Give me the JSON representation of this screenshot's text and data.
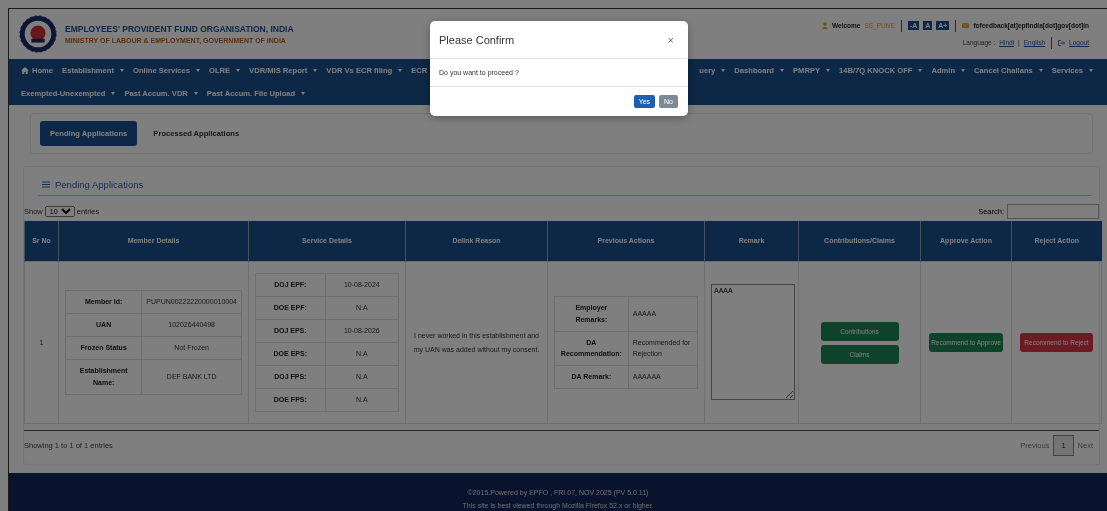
{
  "header": {
    "org_name": "EMPLOYEES' PROVIDENT FUND ORGANISATION, INDIA",
    "ministry": "MINISTRY OF LABOUR & EMPLOYMENT, GOVERNMENT OF INDIA",
    "welcome_label": "Welcome",
    "user": "SS_PUNE",
    "font_buttons": [
      "-A",
      "A",
      "A+"
    ],
    "email": "fofeedback[at]epfindia[dot]gov[dot]in",
    "language_label": "Language :",
    "languages": [
      "Hindi",
      "English"
    ],
    "language_separator": "|",
    "logout": "Logout"
  },
  "nav": {
    "rows": [
      {
        "left": [
          {
            "label": "Home",
            "kind": "home"
          },
          {
            "label": "Establishment",
            "kind": "dropdown"
          },
          {
            "label": "Online Services",
            "kind": "dropdown"
          },
          {
            "label": "OLRE",
            "kind": "dropdown"
          },
          {
            "label": "VDR/MIS Report",
            "kind": "dropdown"
          },
          {
            "label": "VDR Vs ECR filing",
            "kind": "dropdown"
          },
          {
            "label": "ECR",
            "kind": "plain"
          }
        ],
        "right": [
          {
            "label": "uery",
            "kind": "dropdown"
          },
          {
            "label": "Dashboard",
            "kind": "dropdown"
          },
          {
            "label": "PMRPY",
            "kind": "dropdown"
          },
          {
            "label": "14B/7Q KNOCK OFF",
            "kind": "dropdown"
          },
          {
            "label": "Admin",
            "kind": "dropdown"
          },
          {
            "label": "Cancel Challans",
            "kind": "dropdown"
          },
          {
            "label": "Services",
            "kind": "dropdown"
          }
        ]
      },
      {
        "left": [
          {
            "label": "Exempted-Unexempted",
            "kind": "dropdown"
          },
          {
            "label": "Past Accum. VDR",
            "kind": "dropdown"
          },
          {
            "label": "Past Accum. File Upload",
            "kind": "dropdown"
          }
        ],
        "right": []
      }
    ]
  },
  "tabs": [
    {
      "label": "Pending Applications",
      "selected": true
    },
    {
      "label": "Processed Applications",
      "selected": false
    }
  ],
  "panel": {
    "title": "Pending Applications",
    "show_label": "Show",
    "page_size": "10",
    "entries_label": "entries",
    "search_label": "Search:",
    "columns": [
      "Sr No",
      "Member Details",
      "Service Details",
      "Delink Reason",
      "Previous Actions",
      "Remark",
      "Contributions/Claims",
      "Approve Action",
      "Reject Action"
    ],
    "rows": [
      {
        "sr": "1",
        "member_details": [
          {
            "label": "Member Id:",
            "value": "PUPUN00222220000010004"
          },
          {
            "label": "UAN",
            "value": "102026440498"
          },
          {
            "label": "Frozen Status",
            "value": "Not Frozen"
          },
          {
            "label": "Establishment Name:",
            "value": "DEF BANK LTD"
          }
        ],
        "service_details": [
          {
            "label": "DOJ EPF:",
            "value": "10-08-2024"
          },
          {
            "label": "DOE EPF:",
            "value": "N.A"
          },
          {
            "label": "DOJ EPS:",
            "value": "10-08-2026"
          },
          {
            "label": "DOE EPS:",
            "value": "N.A"
          },
          {
            "label": "DOJ FPS:",
            "value": "N.A"
          },
          {
            "label": "DOE FPS:",
            "value": "N.A"
          }
        ],
        "delink_reason": "I never worked in this establishment and my UAN was added without my consent.",
        "previous_actions": [
          {
            "label": "Employer Remarks:",
            "value": "AAAAA"
          },
          {
            "label": "DA Recommendation:",
            "value": "Recommended for Rejection"
          },
          {
            "label": "DA Remark:",
            "value": "AAAAAA"
          }
        ],
        "remark": "AAAA",
        "history_buttons": [
          "Contributions",
          "Claims"
        ],
        "approve": "Recommend to Approve",
        "reject": "Recommend to Reject"
      }
    ],
    "info": "Showing 1 to 1 of 1 entries",
    "previous": "Previous",
    "pages": [
      {
        "label": "1",
        "selected": true
      }
    ],
    "next": "Next"
  },
  "modal": {
    "title": "Please Confirm",
    "close": "×",
    "message": "Do you want to proceed ?",
    "buttons": [
      {
        "label": "Yes",
        "kind": "primary"
      },
      {
        "label": "No",
        "kind": "secondary"
      }
    ]
  },
  "footer": {
    "lines": [
      "©2015.Powered by EPFO , FRI 07, NOV 2025 (PV 5.0.11)",
      "This site is best viewed through Mozilla Firefox 52.x or higher."
    ]
  }
}
